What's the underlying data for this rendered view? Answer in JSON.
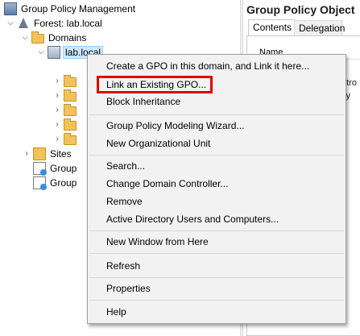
{
  "tree": {
    "root_label": "Group Policy Management",
    "forest_label": "Forest: lab.local",
    "domains_label": "Domains",
    "domain_label": "lab.local",
    "sites_label": "Sites",
    "gp_modeling_label": "Group",
    "gp_results_label": "Group"
  },
  "right_pane": {
    "title": "Group Policy Object",
    "tabs": [
      {
        "label": "Contents",
        "active": true
      },
      {
        "label": "Delegation",
        "active": false
      }
    ],
    "column_header": "Name",
    "row_fragment_1": "ntro",
    "row_fragment_2": "cy"
  },
  "context_menu": {
    "items": [
      {
        "label": "Create a GPO in this domain, and Link it here..."
      },
      {
        "label": "Link an Existing GPO..."
      },
      {
        "label": "Block Inheritance"
      },
      {
        "label": "Group Policy Modeling Wizard..."
      },
      {
        "label": "New Organizational Unit"
      },
      {
        "label": "Search..."
      },
      {
        "label": "Change Domain Controller..."
      },
      {
        "label": "Remove"
      },
      {
        "label": "Active Directory Users and Computers..."
      },
      {
        "label": "New Window from Here"
      },
      {
        "label": "Refresh"
      },
      {
        "label": "Properties"
      },
      {
        "label": "Help"
      }
    ],
    "highlighted_item": "Link an Existing GPO...",
    "highlight_color": "#e00000"
  },
  "colors": {
    "selection_bg": "#cce8ff",
    "menu_bg": "#f2f2f2"
  }
}
